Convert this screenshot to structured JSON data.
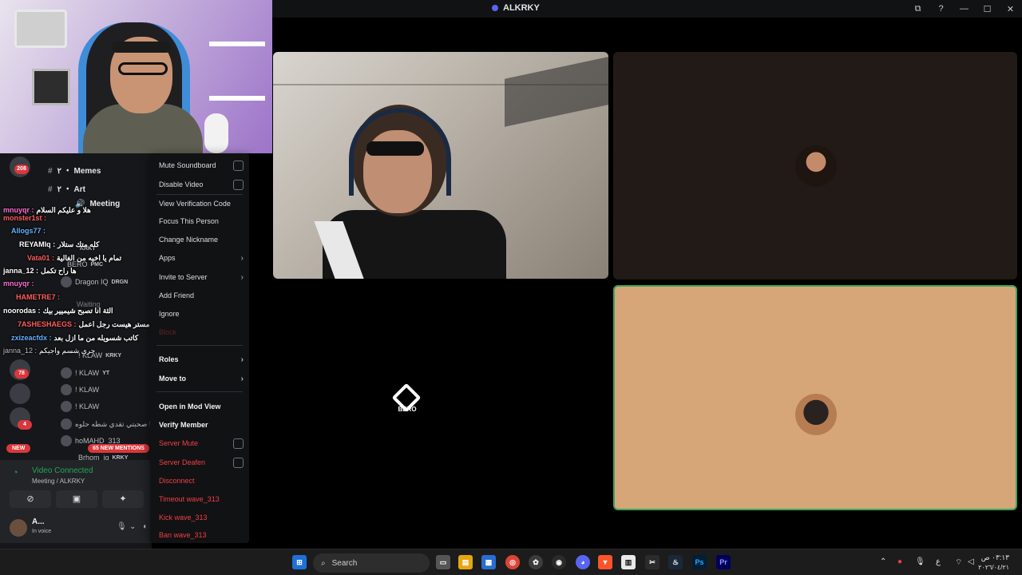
{
  "window": {
    "title": "ALKRKY",
    "controls": [
      "⧉",
      "?",
      "—",
      "☐",
      "✕"
    ]
  },
  "stage": {
    "bero_label": "BERO"
  },
  "sidebar": {
    "badges": [
      "208",
      "78",
      "4"
    ],
    "channels": [
      {
        "hash": "#",
        "label": "٢ ・ Memes"
      },
      {
        "hash": "#",
        "label": "٢ ・ Art"
      },
      {
        "hash": "🔊",
        "label": "Meeting"
      }
    ],
    "members": [
      {
        "name": "KRKY",
        "tag": ""
      },
      {
        "name": "BERO",
        "tag": "PMC"
      },
      {
        "name": "Dragon IQ",
        "tag": "DRGN"
      },
      {
        "name": "Waiting",
        "tag": ""
      },
      {
        "name": "! KLAW",
        "tag": "KRKY"
      },
      {
        "name": "! KLAW",
        "tag": "YT"
      },
      {
        "name": "! KLAW",
        "tag": ""
      },
      {
        "name": "! KLAW",
        "tag": ""
      },
      {
        "name": "صحبتي تقدي شطه حلوه !",
        "tag": ""
      },
      {
        "name": "hoMAHD_313",
        "tag": ""
      },
      {
        "name": "Brhom_iq",
        "tag": "KRKY"
      }
    ],
    "chat": [
      {
        "nick": "mnuyqr :",
        "msg": "هلا و عليكم السلام",
        "color": "#ff6fd0"
      },
      {
        "nick": "monster1st :",
        "msg": "",
        "color": "#ff5d5d"
      },
      {
        "nick": "Allogs77 :",
        "msg": "",
        "color": "#63b3ff"
      },
      {
        "nick": "REYAMIq :",
        "msg": "كله متك ستلار",
        "color": "#ffffff"
      },
      {
        "nick": "Vata01 :",
        "msg": "تمام يا اخيه من الغالية",
        "color": "#ff5d5d"
      },
      {
        "nick": "janna_12 :",
        "msg": "ها راح تكمل",
        "color": "#ffffff"
      },
      {
        "nick": "mnuyqr :",
        "msg": "",
        "color": "#ff6fd0"
      },
      {
        "nick": "HAMETRE7 :",
        "msg": "",
        "color": "#ff5d5d"
      },
      {
        "nick": "noorodas :",
        "msg": "الثة انا تصبح شيميير بيك",
        "color": "#ffffff"
      },
      {
        "nick": "7ASHESHAEGS :",
        "msg": "مو انت مستر هيست رجل اعمل",
        "color": "#ff5d5d"
      },
      {
        "nick": "zxizeacfdx :",
        "msg": "كاتب شسويله من ما ازل بعد",
        "color": "#63b3ff"
      },
      {
        "nick": "janna_12 :",
        "msg": "جرى شسم واجيكم",
        "color": "#b5bac1"
      }
    ],
    "new_label": "NEW",
    "mentions_label": "65 NEW MENTIONS",
    "voice": {
      "status": "Video Connected",
      "channel": "Meeting / ALKRKY",
      "user_name": "A...",
      "user_status": "In voice"
    }
  },
  "context_menu": {
    "items": [
      {
        "label": "Mute Soundboard",
        "type": "check"
      },
      {
        "label": "Disable Video",
        "type": "check"
      },
      {
        "label": "View Verification Code",
        "type": "plain"
      },
      {
        "label": "Focus This Person",
        "type": "plain"
      },
      {
        "label": "Change Nickname",
        "type": "plain"
      },
      {
        "label": "Apps",
        "type": "sub"
      },
      {
        "label": "Invite to Server",
        "type": "sub"
      },
      {
        "label": "Add Friend",
        "type": "plain"
      },
      {
        "label": "Ignore",
        "type": "plain"
      },
      {
        "label": "Block",
        "type": "disabled"
      },
      {
        "label": "Roles",
        "type": "sub-bold"
      },
      {
        "label": "Move to",
        "type": "sub-bold"
      },
      {
        "label": "Open in Mod View",
        "type": "bold"
      },
      {
        "label": "Verify Member",
        "type": "bold"
      },
      {
        "label": "Server Mute",
        "type": "danger-check"
      },
      {
        "label": "Server Deafen",
        "type": "danger-check"
      },
      {
        "label": "Disconnect",
        "type": "danger"
      },
      {
        "label": "Timeout wave_313",
        "type": "danger"
      },
      {
        "label": "Kick wave_313",
        "type": "danger"
      },
      {
        "label": "Ban wave_313",
        "type": "danger"
      }
    ]
  },
  "taskbar": {
    "search_placeholder": "Search",
    "clock_time": "٠٣:١٣ ص",
    "clock_date": "٢٠٢٦/٠٤/٢١",
    "lang": "ع"
  }
}
